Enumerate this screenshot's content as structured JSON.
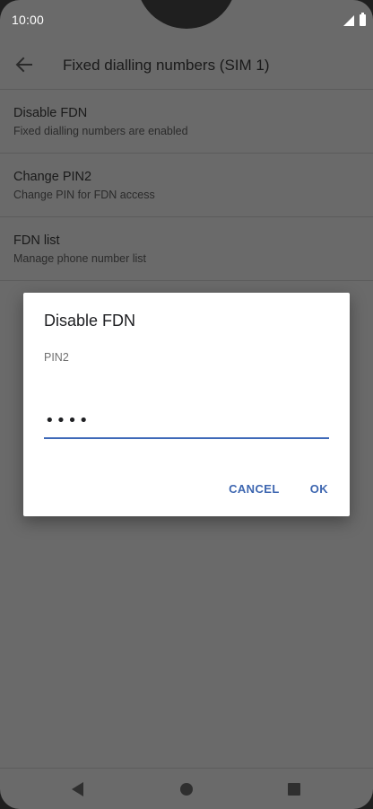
{
  "status_bar": {
    "time": "10:00",
    "icons": [
      "signal-icon",
      "battery-icon"
    ]
  },
  "app_bar": {
    "back_icon": "arrow-left-icon",
    "title": "Fixed dialling numbers (SIM 1)"
  },
  "settings_list": {
    "items": [
      {
        "title": "Disable FDN",
        "subtitle": "Fixed dialling numbers are enabled"
      },
      {
        "title": "Change PIN2",
        "subtitle": "Change PIN for FDN access"
      },
      {
        "title": "FDN list",
        "subtitle": "Manage phone number list"
      }
    ]
  },
  "dialog": {
    "title": "Disable FDN",
    "field_label": "PIN2",
    "field_value": "••••",
    "cancel_label": "CANCEL",
    "ok_label": "OK"
  },
  "nav_bar": {
    "icons": [
      "back-triangle-icon",
      "home-circle-icon",
      "recents-square-icon"
    ]
  },
  "colors": {
    "accent": "#3d66b0",
    "scrim_background": "#6a6a6a",
    "dialog_background": "#ffffff"
  }
}
